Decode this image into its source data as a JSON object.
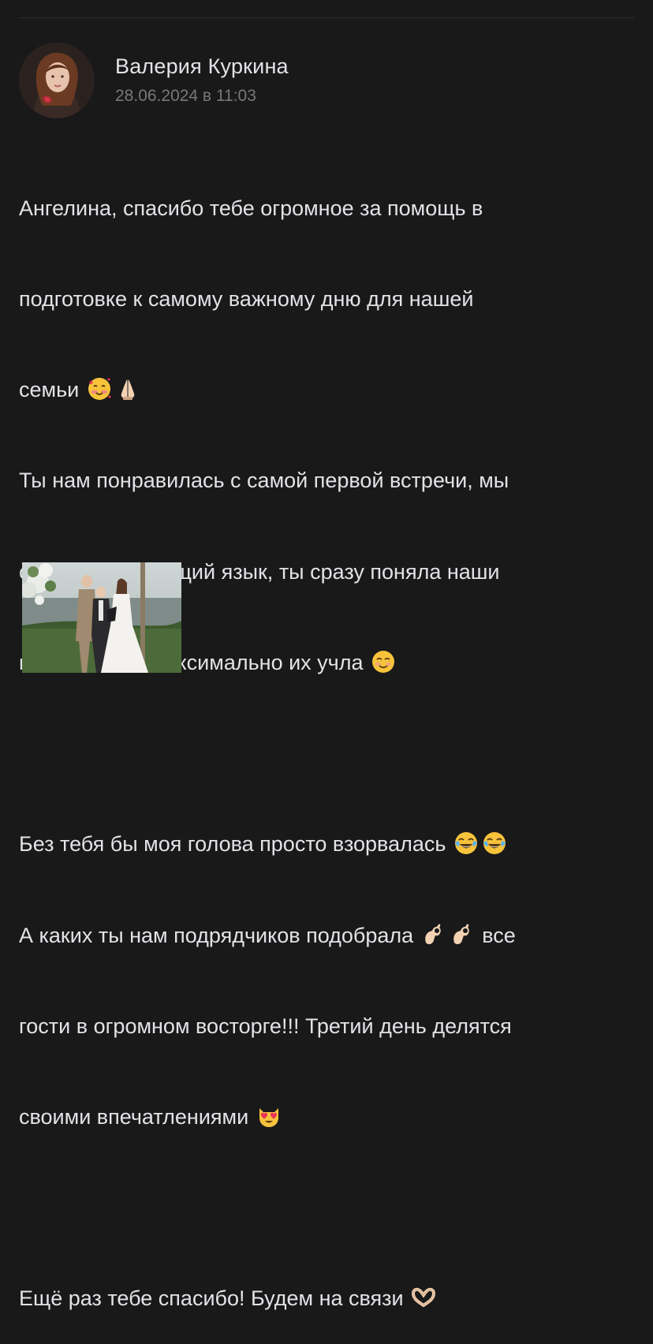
{
  "post": {
    "author_name": "Валерия Куркина",
    "date": "28.06.2024 в 11:03",
    "text_lines": [
      "Ангелина, спасибо тебе огромное за помощь в",
      "подготовке к самому важному дню для нашей",
      "семьи",
      "Ты нам понравилась с самой первой встречи, мы",
      "сразу нашли общий язык, ты сразу поняла наши",
      "пожелания и максимально их учла",
      "",
      "Без тебя бы моя голова просто взорвалась",
      "А каких ты нам подрядчиков подобрала",
      "гости в огромном восторге!!! Третий день делятся",
      "своими впечатлениями",
      "",
      "Ещё раз тебе спасибо! Будем на связи"
    ],
    "after_emoji_text": "все",
    "emojis": {
      "line3": [
        "smiling-face-with-hearts",
        "folded-hands"
      ],
      "line6": [
        "smiling-face"
      ],
      "line8": [
        "tears-of-joy",
        "tears-of-joy"
      ],
      "line9": [
        "ok-hand",
        "ok-hand"
      ],
      "line11": [
        "heart-eyes-cat"
      ],
      "line13": [
        "heart-hands"
      ]
    },
    "attachment": {
      "type": "photo",
      "description_icon": "wedding-photo"
    }
  },
  "colors": {
    "background": "#19191a",
    "text_primary": "#e1e3e6",
    "text_secondary": "#76787a",
    "divider": "#2c2d2e"
  }
}
